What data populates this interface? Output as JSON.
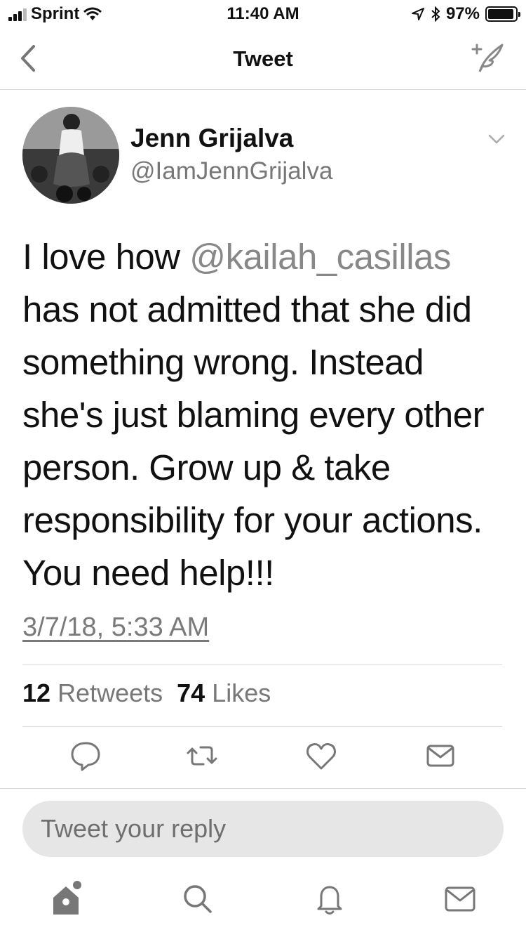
{
  "status_bar": {
    "carrier": "Sprint",
    "time": "11:40 AM",
    "battery": "97%",
    "battery_level": 0.97
  },
  "nav": {
    "title": "Tweet",
    "back_icon": "chevron-left-icon",
    "compose_icon": "compose-quill-icon"
  },
  "tweet": {
    "name": "Jenn Grijalva",
    "handle": "@IamJennGrijalva",
    "text_before_mention": "I love how ",
    "mention": "@kailah_casillas",
    "text_after_mention": " has not admitted that she did something wrong. Instead she's just blaming every other person. Grow up & take responsibility for your actions. You need help!!!",
    "timestamp": "3/7/18, 5:33 AM",
    "retweets_count": "12",
    "retweets_label": "Retweets",
    "likes_count": "74",
    "likes_label": "Likes"
  },
  "actions": [
    "reply-icon",
    "retweet-icon",
    "like-icon",
    "direct-message-icon"
  ],
  "reply": {
    "placeholder": "Tweet your reply"
  },
  "tabbar": [
    "home-icon",
    "search-icon",
    "notifications-icon",
    "messages-icon"
  ],
  "colors": {
    "text": "#111111",
    "secondary": "#777777",
    "reply_bg": "#e6e6e6",
    "divider": "#d8d8d8"
  }
}
